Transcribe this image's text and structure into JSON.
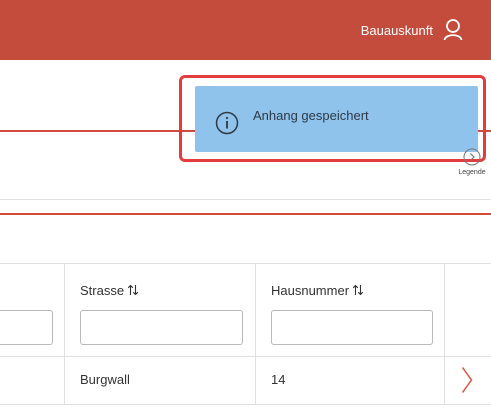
{
  "header": {
    "user_label": "Bauauskunft",
    "bar_color": "#c44c3d",
    "user_icon": "user-icon"
  },
  "toast": {
    "message": "Anhang gespeichert",
    "icon": "info-icon",
    "background": "#8fc3ec",
    "highlight_color": "#e43c3c"
  },
  "legend": {
    "label": "Legende",
    "icon": "chevron-circle-icon"
  },
  "table": {
    "columns": [
      {
        "title": "Strasse",
        "sortable": true,
        "filter_value": ""
      },
      {
        "title": "Hausnummer",
        "sortable": true,
        "filter_value": ""
      }
    ],
    "rows": [
      {
        "strasse": "Burgwall",
        "hausnummer": "14"
      }
    ]
  }
}
